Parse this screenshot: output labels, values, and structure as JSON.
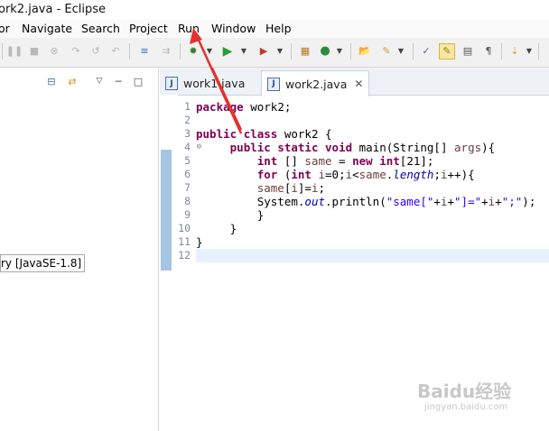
{
  "window": {
    "title": "ork2.java - Eclipse"
  },
  "menubar": [
    "or",
    "Navigate",
    "Search",
    "Project",
    "Run",
    "Window",
    "Help"
  ],
  "toolbar": {
    "icons": [
      "suspend-icon",
      "terminate-icon",
      "disconnect-icon",
      "step-into-icon",
      "step-over-icon",
      "step-return-icon",
      "drop-to-frame-icon",
      "use-step-filters-icon",
      "debug-icon",
      "run-icon",
      "run-external-tool-icon",
      "new-java-project-icon",
      "new-class-icon",
      "open-type-icon",
      "search-icon",
      "next-annotation-icon",
      "toggle-mark-occurrences-icon",
      "toggle-block-selection-icon",
      "show-whitespace-icon",
      "next-edit-icon"
    ]
  },
  "left_panel": {
    "jre_item": "ry [JavaSE-1.8]"
  },
  "editor": {
    "tabs": [
      {
        "label": "work1.java",
        "active": false
      },
      {
        "label": "work2.java",
        "active": true
      }
    ],
    "line_numbers": [
      "1",
      "2",
      "3",
      "4",
      "5",
      "6",
      "7",
      "8",
      "9",
      "10",
      "11",
      "12"
    ],
    "code_lines": [
      [
        {
          "t": "kw",
          "v": "package"
        },
        {
          "t": "p",
          "v": " work2;"
        }
      ],
      [],
      [
        {
          "t": "kw",
          "v": "public"
        },
        {
          "t": "p",
          "v": " "
        },
        {
          "t": "kw",
          "v": "class"
        },
        {
          "t": "p",
          "v": " work2 {"
        }
      ],
      [
        {
          "t": "p",
          "v": "     "
        },
        {
          "t": "kw",
          "v": "public"
        },
        {
          "t": "p",
          "v": " "
        },
        {
          "t": "kw",
          "v": "static"
        },
        {
          "t": "p",
          "v": " "
        },
        {
          "t": "kw",
          "v": "void"
        },
        {
          "t": "p",
          "v": " main(String[] "
        },
        {
          "t": "var",
          "v": "args"
        },
        {
          "t": "p",
          "v": "){"
        }
      ],
      [
        {
          "t": "p",
          "v": "         "
        },
        {
          "t": "kw",
          "v": "int"
        },
        {
          "t": "p",
          "v": " [] "
        },
        {
          "t": "var",
          "v": "same"
        },
        {
          "t": "p",
          "v": " = "
        },
        {
          "t": "kw",
          "v": "new"
        },
        {
          "t": "p",
          "v": " "
        },
        {
          "t": "kw",
          "v": "int"
        },
        {
          "t": "p",
          "v": "[21];"
        }
      ],
      [
        {
          "t": "p",
          "v": "         "
        },
        {
          "t": "kw",
          "v": "for"
        },
        {
          "t": "p",
          "v": " ("
        },
        {
          "t": "kw",
          "v": "int"
        },
        {
          "t": "p",
          "v": " "
        },
        {
          "t": "var",
          "v": "i"
        },
        {
          "t": "p",
          "v": "=0;"
        },
        {
          "t": "var",
          "v": "i"
        },
        {
          "t": "p",
          "v": "<"
        },
        {
          "t": "var",
          "v": "same"
        },
        {
          "t": "p",
          "v": "."
        },
        {
          "t": "it",
          "v": "length"
        },
        {
          "t": "p",
          "v": ";"
        },
        {
          "t": "var",
          "v": "i"
        },
        {
          "t": "p",
          "v": "++){"
        }
      ],
      [
        {
          "t": "p",
          "v": "         "
        },
        {
          "t": "var",
          "v": "same"
        },
        {
          "t": "p",
          "v": "["
        },
        {
          "t": "var",
          "v": "i"
        },
        {
          "t": "p",
          "v": "]="
        },
        {
          "t": "var",
          "v": "i"
        },
        {
          "t": "p",
          "v": ";"
        }
      ],
      [
        {
          "t": "p",
          "v": "         System."
        },
        {
          "t": "it",
          "v": "out"
        },
        {
          "t": "p",
          "v": ".println("
        },
        {
          "t": "str",
          "v": "\"same[\""
        },
        {
          "t": "p",
          "v": "+"
        },
        {
          "t": "var",
          "v": "i"
        },
        {
          "t": "p",
          "v": "+"
        },
        {
          "t": "str",
          "v": "\"]=\""
        },
        {
          "t": "p",
          "v": "+"
        },
        {
          "t": "var",
          "v": "i"
        },
        {
          "t": "p",
          "v": "+"
        },
        {
          "t": "str",
          "v": "\";\""
        },
        {
          "t": "p",
          "v": ");"
        }
      ],
      [
        {
          "t": "p",
          "v": "         }"
        }
      ],
      [
        {
          "t": "p",
          "v": "     }"
        }
      ],
      [
        {
          "t": "p",
          "v": "}"
        }
      ],
      []
    ]
  },
  "colors": {
    "keyword": "#7f0055",
    "string": "#2a00ff",
    "field": "#0000c0",
    "variable": "#6a3e3e",
    "annotation_arrow": "#e53030"
  },
  "watermark": {
    "text": "Baidu经验",
    "sub": "jingyan.baidu.com"
  }
}
